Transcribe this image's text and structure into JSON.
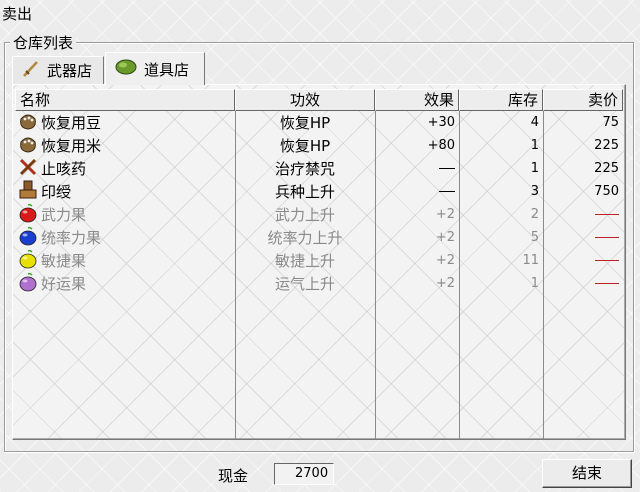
{
  "window": {
    "title": "卖出"
  },
  "group": {
    "label": "仓库列表"
  },
  "tabs": [
    {
      "label": "武器店",
      "icon": "sword-icon"
    },
    {
      "label": "道具店",
      "icon": "bean-icon",
      "active": true
    }
  ],
  "table": {
    "headers": {
      "name": "名称",
      "effect": "功效",
      "value": "效果",
      "stock": "库存",
      "price": "卖价"
    },
    "rows": [
      {
        "icon": "bean-pouch-icon",
        "name": "恢复用豆",
        "effect": "恢复HP",
        "value": "+30",
        "stock": "4",
        "price": "75",
        "enabled": true
      },
      {
        "icon": "rice-pouch-icon",
        "name": "恢复用米",
        "effect": "恢复HP",
        "value": "+80",
        "stock": "1",
        "price": "225",
        "enabled": true
      },
      {
        "icon": "herb-icon",
        "name": "止咳药",
        "effect": "治疗禁咒",
        "value": "—",
        "stock": "1",
        "price": "225",
        "enabled": true
      },
      {
        "icon": "seal-icon",
        "name": "印绶",
        "effect": "兵种上升",
        "value": "—",
        "stock": "3",
        "price": "750",
        "enabled": true
      },
      {
        "icon": "red-fruit-icon",
        "name": "武力果",
        "effect": "武力上升",
        "value": "+2",
        "stock": "2",
        "price": "",
        "enabled": false
      },
      {
        "icon": "blue-fruit-icon",
        "name": "统率力果",
        "effect": "统率力上升",
        "value": "+2",
        "stock": "5",
        "price": "",
        "enabled": false
      },
      {
        "icon": "yellow-fruit-icon",
        "name": "敏捷果",
        "effect": "敏捷上升",
        "value": "+2",
        "stock": "11",
        "price": "",
        "enabled": false
      },
      {
        "icon": "purple-fruit-icon",
        "name": "好运果",
        "effect": "运气上升",
        "value": "+2",
        "stock": "1",
        "price": "",
        "enabled": false
      }
    ]
  },
  "footer": {
    "money_label": "现金",
    "money_value": "2700",
    "end_label": "结束"
  },
  "colors": {
    "red_fruit": "#d81a1a",
    "blue_fruit": "#1a3fd0",
    "yellow_fruit": "#e8e000",
    "purple_fruit": "#b070d0"
  }
}
